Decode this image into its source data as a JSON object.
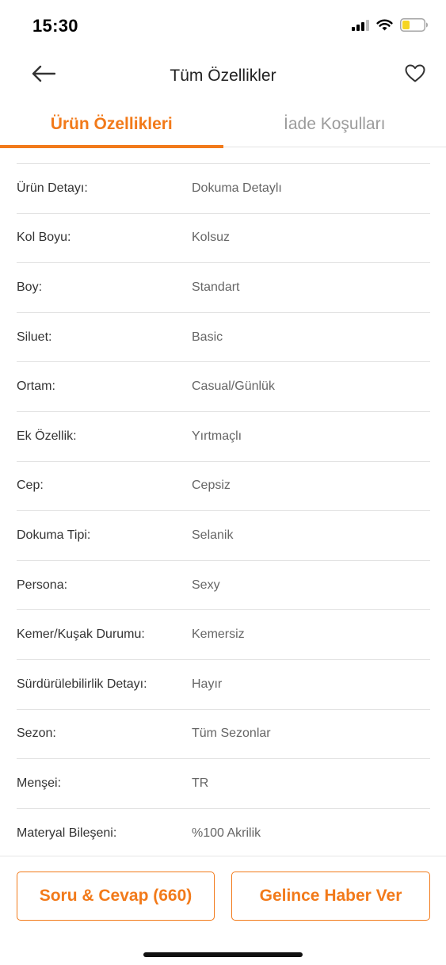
{
  "status_bar": {
    "time": "15:30",
    "icons": [
      "signal-icon",
      "wifi-icon",
      "battery-icon"
    ],
    "battery_color": "#f5d523"
  },
  "nav": {
    "title": "Tüm Özellikler",
    "back_icon": "arrow-left-icon",
    "favorite_icon": "heart-outline-icon"
  },
  "tabs": [
    {
      "label": "Ürün Özellikleri",
      "active": true
    },
    {
      "label": "İade Koşulları",
      "active": false
    }
  ],
  "attributes": [
    {
      "key": "Ürün Detayı:",
      "value": "Dokuma Detaylı"
    },
    {
      "key": "Kol Boyu:",
      "value": "Kolsuz"
    },
    {
      "key": "Boy:",
      "value": "Standart"
    },
    {
      "key": "Siluet:",
      "value": "Basic"
    },
    {
      "key": "Ortam:",
      "value": "Casual/Günlük"
    },
    {
      "key": "Ek Özellik:",
      "value": "Yırtmaçlı"
    },
    {
      "key": "Cep:",
      "value": "Cepsiz"
    },
    {
      "key": "Dokuma Tipi:",
      "value": "Selanik"
    },
    {
      "key": "Persona:",
      "value": "Sexy"
    },
    {
      "key": "Kemer/Kuşak Durumu:",
      "value": "Kemersiz"
    },
    {
      "key": "Sürdürülebilirlik Detayı:",
      "value": "Hayır"
    },
    {
      "key": "Sezon:",
      "value": "Tüm Sezonlar"
    },
    {
      "key": "Menşei:",
      "value": "TR"
    },
    {
      "key": "Materyal Bileşeni:",
      "value": "%100 Akrilik"
    }
  ],
  "bottom_bar": {
    "qa_button": "Soru & Cevap (660)",
    "notify_button": "Gelince Haber Ver"
  },
  "colors": {
    "accent": "#f27a1a",
    "inactive_tab": "#9b9b9b",
    "divider": "#e3e3e3"
  }
}
